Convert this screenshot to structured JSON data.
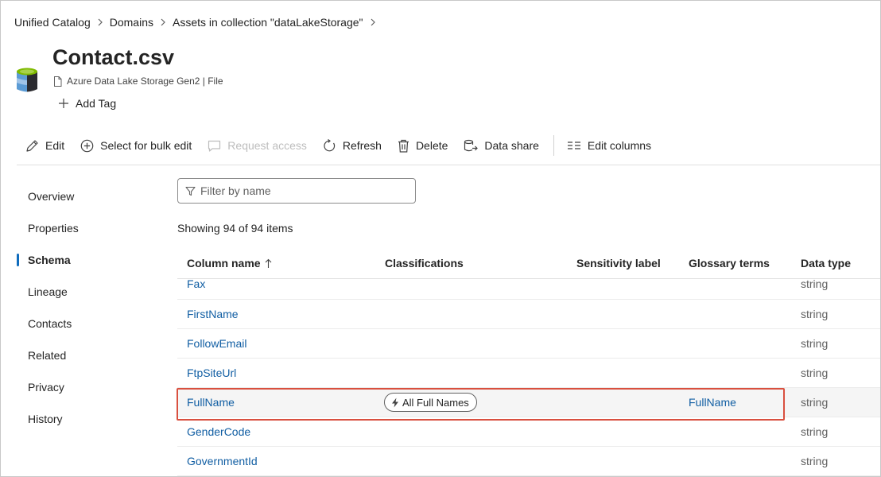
{
  "breadcrumb": {
    "items": [
      "Unified Catalog",
      "Domains",
      "Assets in collection \"dataLakeStorage\""
    ]
  },
  "asset": {
    "title": "Contact.csv",
    "subtitle": "Azure Data Lake Storage Gen2 | File",
    "add_tag_label": "Add Tag",
    "icon": "storage-database-icon"
  },
  "toolbar": {
    "edit": "Edit",
    "bulk_edit": "Select for bulk edit",
    "request_access": "Request access",
    "refresh": "Refresh",
    "delete": "Delete",
    "data_share": "Data share",
    "edit_columns": "Edit columns"
  },
  "nav": {
    "items": [
      "Overview",
      "Properties",
      "Schema",
      "Lineage",
      "Contacts",
      "Related",
      "Privacy",
      "History"
    ],
    "active": "Schema"
  },
  "filter": {
    "placeholder": "Filter by name",
    "value": ""
  },
  "summary": "Showing 94 of 94 items",
  "table": {
    "headers": {
      "column_name": "Column name",
      "classifications": "Classifications",
      "sensitivity_label": "Sensitivity label",
      "glossary_terms": "Glossary terms",
      "data_type": "Data type"
    },
    "sort": "ascending",
    "rows": [
      {
        "name": "Fax",
        "classification": "",
        "sensitivity": "",
        "glossary": "",
        "type": "string"
      },
      {
        "name": "FirstName",
        "classification": "",
        "sensitivity": "",
        "glossary": "",
        "type": "string"
      },
      {
        "name": "FollowEmail",
        "classification": "",
        "sensitivity": "",
        "glossary": "",
        "type": "string"
      },
      {
        "name": "FtpSiteUrl",
        "classification": "",
        "sensitivity": "",
        "glossary": "",
        "type": "string"
      },
      {
        "name": "FullName",
        "classification": "All Full Names",
        "sensitivity": "",
        "glossary": "FullName",
        "type": "string"
      },
      {
        "name": "GenderCode",
        "classification": "",
        "sensitivity": "",
        "glossary": "",
        "type": "string"
      },
      {
        "name": "GovernmentId",
        "classification": "",
        "sensitivity": "",
        "glossary": "",
        "type": "string"
      }
    ]
  },
  "colors": {
    "link": "#115ea3",
    "accent": "#0f6cbd",
    "highlight": "#d9503f",
    "selected_row": "#f5f5f5"
  }
}
